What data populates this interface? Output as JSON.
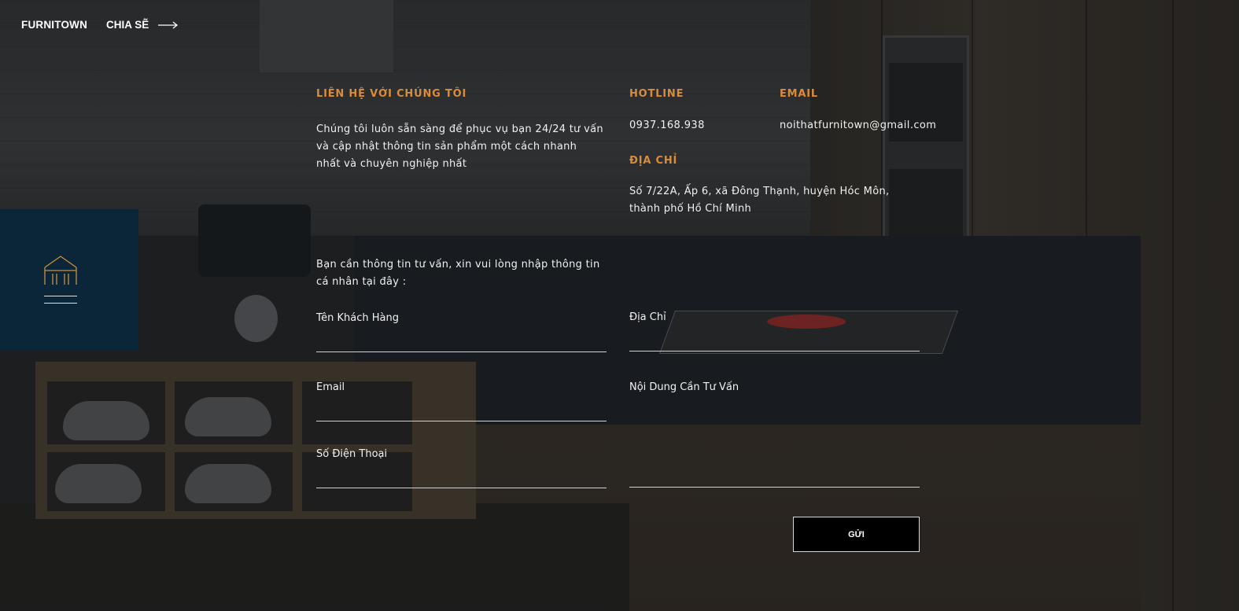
{
  "nav": {
    "brand": "FURNITOWN",
    "share_label": "CHIA SẼ"
  },
  "contact": {
    "heading": "LIÊN HỆ VỚI CHÚNG TÔI",
    "intro": "Chúng tôi luôn sẵn sàng để phục vụ bạn 24/24 tư vấn và cập nhật thông tin sản phẩm một cách nhanh nhất và chuyên nghiệp nhất",
    "hotline_heading": "HOTLINE",
    "hotline": "0937.168.938",
    "email_heading": "EMAIL",
    "email": "noithatfurnitown@gmail.com",
    "address_heading": "ĐỊA CHỈ",
    "address": "Số 7/22A, Ấp 6, xã Đông Thạnh, huyện Hóc Môn, thành phố Hồ Chí Minh"
  },
  "form": {
    "prompt": "Bạn cần thông tin tư vấn, xin vui lòng nhập thông tin cá nhân tại đây :",
    "name_label": "Tên Khách Hàng",
    "name_value": "",
    "address_label": "Địa Chỉ",
    "address_value": "",
    "email_label": "Email",
    "email_value": "",
    "content_label": "Nội Dung Cần Tư Vấn",
    "content_value": "",
    "phone_label": "Số Điện Thoại",
    "phone_value": "",
    "submit_label": "GỬI"
  },
  "icons": {
    "share_arrow": "long-arrow-right-icon",
    "home": "home-outline-icon",
    "menu": "menu-lines-icon"
  },
  "colors": {
    "accent": "#d98c3a",
    "navy_block": "#0b2539",
    "button_bg": "#000000"
  }
}
